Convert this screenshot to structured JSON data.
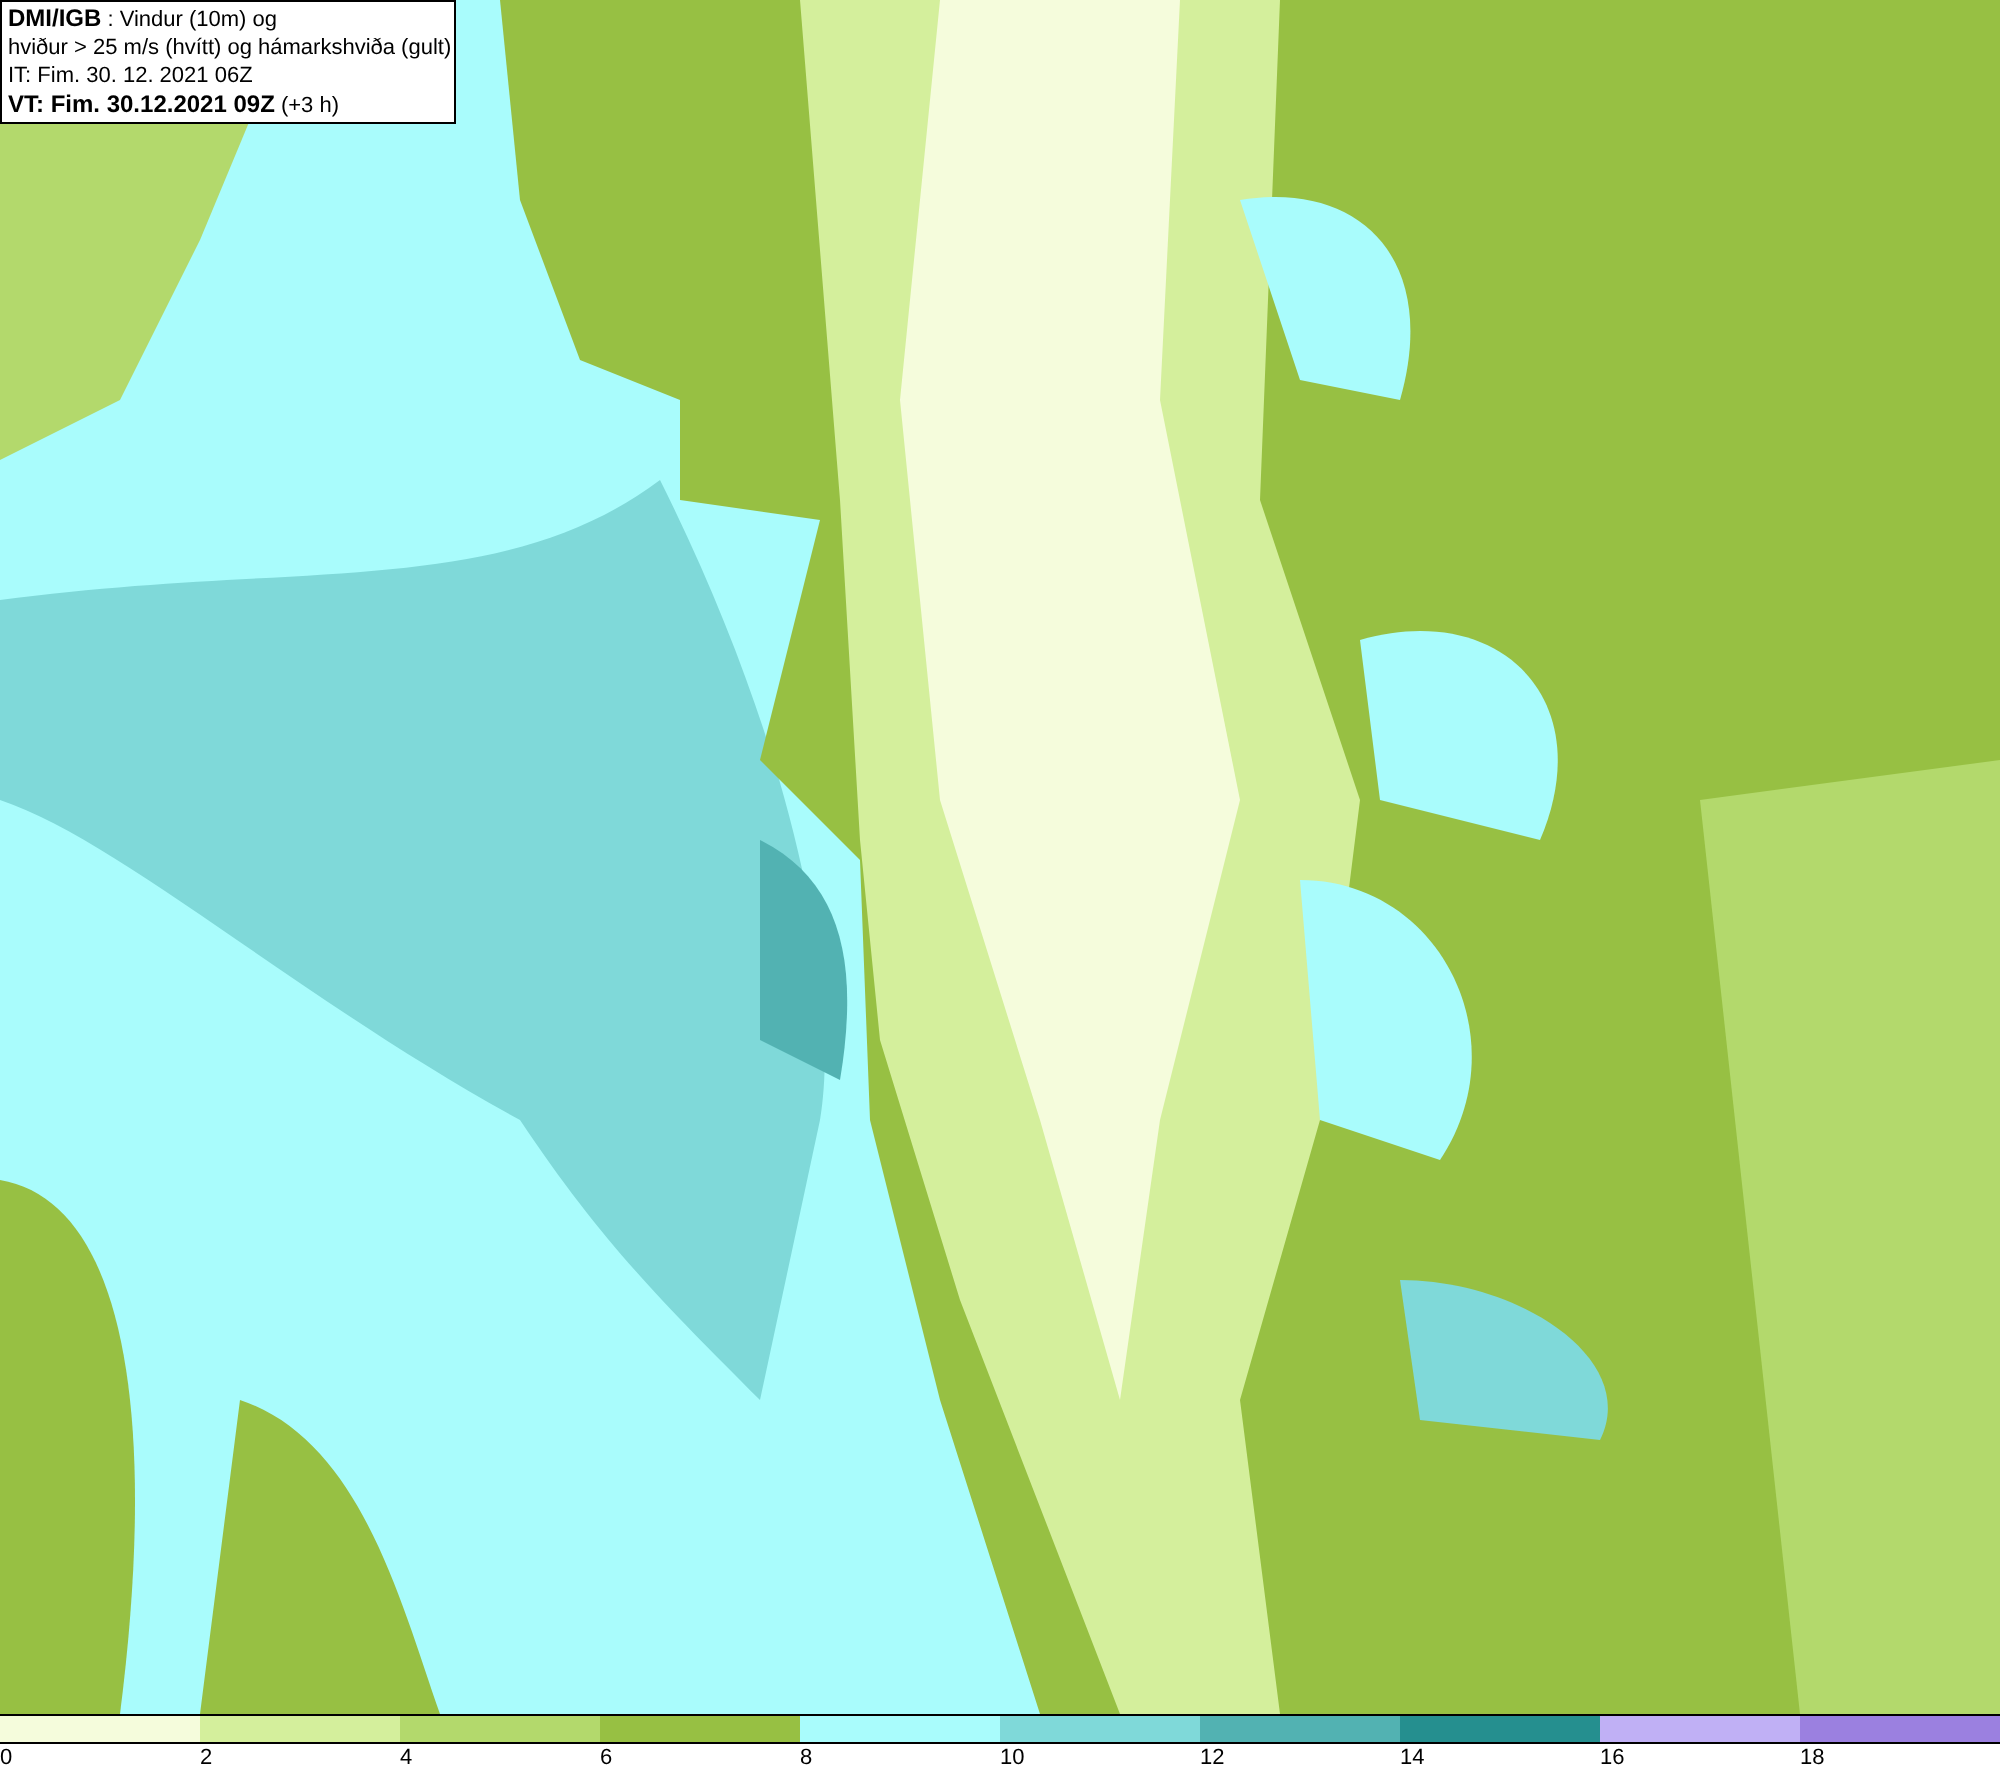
{
  "map": {
    "header": {
      "lines": [
        "**DMI/IGB** : Vindur (10m) og",
        "hviður > 25 m/s (hvítt) og hámarkshviða (gult)",
        "IT: Fim. 30. 12. 2021 06Z",
        "**VT: Fim. 30.12.2021 09Z** (+3 h)"
      ]
    }
  },
  "legend": {
    "segments": [
      {
        "color": "#f5fcdc",
        "label": "0"
      },
      {
        "color": "#d4ef9c",
        "label": "2"
      },
      {
        "color": "#b3d96c",
        "label": "4"
      },
      {
        "color": "#97c043",
        "label": "6"
      },
      {
        "color": "#a9fcfc",
        "label": "8"
      },
      {
        "color": "#7fd9d9",
        "label": "10"
      },
      {
        "color": "#52b2b2",
        "label": "12"
      },
      {
        "color": "#258f8f",
        "label": "14"
      },
      {
        "color": "#c0b0f5",
        "label": "16"
      },
      {
        "color": "#9b80e0",
        "label": "18"
      }
    ]
  }
}
